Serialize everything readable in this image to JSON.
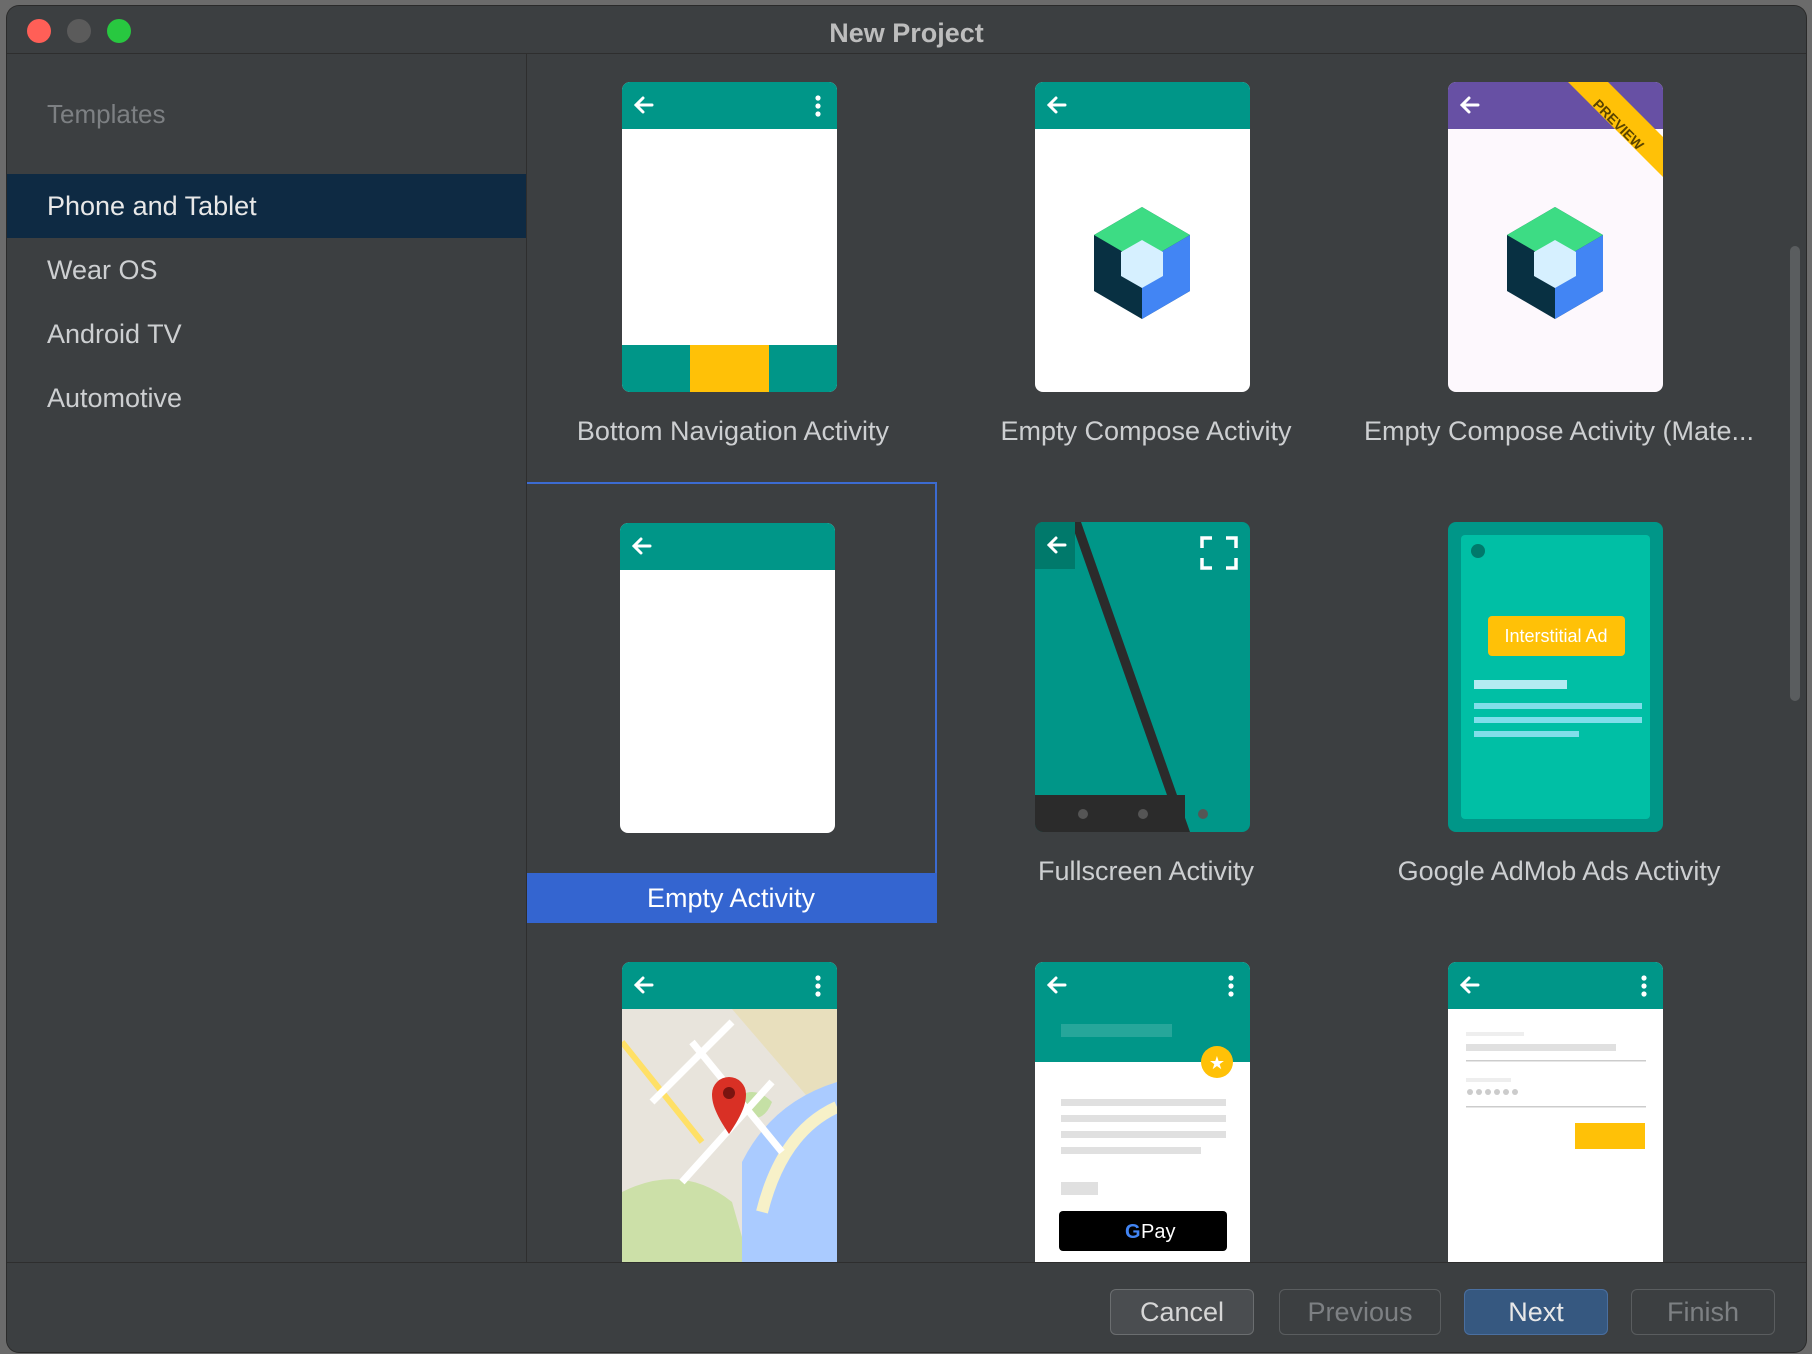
{
  "window": {
    "title": "New Project"
  },
  "sidebar": {
    "heading": "Templates",
    "items": [
      {
        "label": "Phone and Tablet",
        "selected": true
      },
      {
        "label": "Wear OS",
        "selected": false
      },
      {
        "label": "Android TV",
        "selected": false
      },
      {
        "label": "Automotive",
        "selected": false
      }
    ]
  },
  "templates": [
    {
      "label": "Bottom Navigation Activity",
      "selected": false
    },
    {
      "label": "Empty Compose Activity",
      "selected": false
    },
    {
      "label": "Empty Compose Activity (Mate...",
      "selected": false,
      "badge": "PREVIEW"
    },
    {
      "label": "Empty Activity",
      "selected": true
    },
    {
      "label": "Fullscreen Activity",
      "selected": false
    },
    {
      "label": "Google AdMob Ads Activity",
      "selected": false,
      "ad_label": "Interstitial Ad"
    },
    {
      "label": "",
      "selected": false
    },
    {
      "label": "",
      "selected": false,
      "pay_label": "Pay"
    },
    {
      "label": "",
      "selected": false
    }
  ],
  "buttons": {
    "cancel": "Cancel",
    "previous": "Previous",
    "next": "Next",
    "finish": "Finish"
  },
  "colors": {
    "teal": "#009688",
    "purple": "#6750a4",
    "accent_yellow": "#ffc107",
    "selection_blue": "#3465d0",
    "sidebar_selected": "#0e2a43"
  }
}
